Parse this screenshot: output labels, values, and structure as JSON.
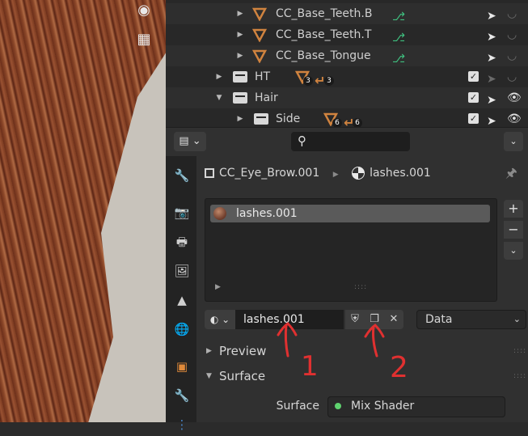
{
  "outliner": {
    "rows": [
      {
        "label": "CC_Base_Teeth.B"
      },
      {
        "label": "CC_Base_Teeth.T"
      },
      {
        "label": "CC_Base_Tongue"
      },
      {
        "label": "HT",
        "badge1": "3",
        "badge2": "3"
      },
      {
        "label": "Hair"
      },
      {
        "label": "Side",
        "badge1": "6",
        "badge2": "6"
      }
    ]
  },
  "context": {
    "object_name": "CC_Eye_Brow.001",
    "material_name": "lashes.001"
  },
  "material_slots": [
    {
      "label": "lashes.001"
    }
  ],
  "datablock": {
    "name": "lashes.001",
    "link": "Data"
  },
  "panels": {
    "preview": "Preview",
    "surface": "Surface"
  },
  "surface": {
    "label": "Surface",
    "value": "Mix Shader"
  },
  "annotations": {
    "mark1": "1",
    "mark2": "2"
  },
  "colors": {
    "mesh_icon": "#d0833f",
    "vertex_group": "#3fbf7f",
    "shader_dot": "#5fd36f",
    "annotation": "#e03030"
  }
}
